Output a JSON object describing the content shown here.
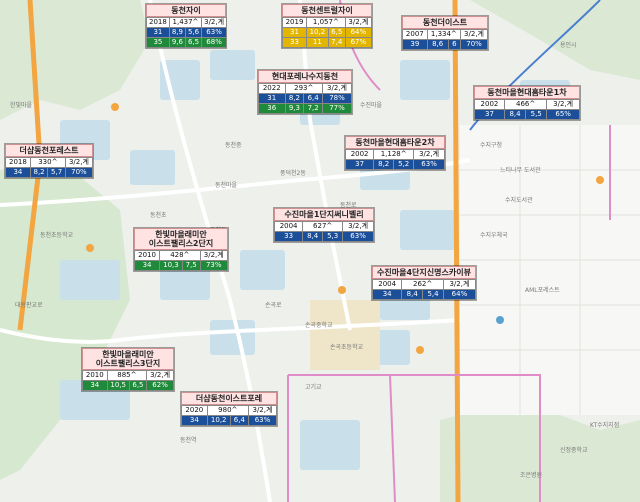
{
  "colors": {
    "title_bg": "#ffe3e3",
    "blue_row": "#1c4f9a",
    "green_row": "#1f8a3a",
    "yellow_row": "#e2b500",
    "road_pink": "#e08cc8",
    "road_orange": "#f2a540",
    "block_blue": "#c9e0ea"
  },
  "cards": [
    {
      "name": "동천자이",
      "title_lines": [
        "동천자이"
      ],
      "year": "2018",
      "units": "1,437^",
      "type": "3/2,계",
      "rows": [
        {
          "color": "blue",
          "cells": [
            "31",
            "8,9",
            "5,6",
            "63%"
          ]
        },
        {
          "color": "green",
          "cells": [
            "35",
            "9,6",
            "6,5",
            "68%"
          ]
        }
      ]
    },
    {
      "name": "동천센트럴자이",
      "title_lines": [
        "동천센트럴자이"
      ],
      "year": "2019",
      "units": "1,057^",
      "type": "3/2,계",
      "rows": [
        {
          "color": "yellow",
          "cells": [
            "31",
            "10,2",
            "6,5",
            "64%"
          ]
        },
        {
          "color": "yellow",
          "cells": [
            "33",
            "11",
            "7,4",
            "67%"
          ]
        }
      ]
    },
    {
      "name": "동천더이스트",
      "title_lines": [
        "동천더이스트"
      ],
      "year": "2007",
      "units": "1,334^",
      "type": "3/2,계",
      "rows": [
        {
          "color": "blue",
          "cells": [
            "39",
            "8,6",
            "6",
            "70%"
          ]
        }
      ]
    },
    {
      "name": "현대포레나수지동천",
      "title_lines": [
        "현대포레나수지동천"
      ],
      "year": "2022",
      "units": "293^",
      "type": "3/2,계",
      "rows": [
        {
          "color": "blue",
          "cells": [
            "31",
            "8,2",
            "6,4",
            "78%"
          ]
        },
        {
          "color": "green",
          "cells": [
            "36",
            "9,3",
            "7,2",
            "77%"
          ]
        }
      ]
    },
    {
      "name": "동천마을현대홈타운1차",
      "title_lines": [
        "동천마을현대홈타운1차"
      ],
      "year": "2002",
      "units": "466^",
      "type": "3/2,계",
      "rows": [
        {
          "color": "blue",
          "cells": [
            "37",
            "8,4",
            "5,5",
            "65%"
          ]
        }
      ]
    },
    {
      "name": "더샵동천포레스트",
      "title_lines": [
        "더샵동천포레스트"
      ],
      "year": "2018",
      "units": "330^",
      "type": "3/2,계",
      "rows": [
        {
          "color": "blue",
          "cells": [
            "34",
            "8,2",
            "5,7",
            "70%"
          ]
        }
      ]
    },
    {
      "name": "동천마을현대홈타운2차",
      "title_lines": [
        "동천마을현대홈타운2차"
      ],
      "year": "2002",
      "units": "1,128^",
      "type": "3/2,계",
      "rows": [
        {
          "color": "blue",
          "cells": [
            "37",
            "8,2",
            "5,2",
            "63%"
          ]
        }
      ]
    },
    {
      "name": "수진마을1단지써니벨리",
      "title_lines": [
        "수진마을1단지써니벨리"
      ],
      "year": "2004",
      "units": "627^",
      "type": "3/2,계",
      "rows": [
        {
          "color": "blue",
          "cells": [
            "33",
            "8,4",
            "5,3",
            "63%"
          ]
        }
      ]
    },
    {
      "name": "한빛마을래미안 이스트팰리스2단지",
      "title_lines": [
        "한빛마을래미안",
        "이스트팰리스2단지"
      ],
      "year": "2010",
      "units": "428^",
      "type": "3/2,계",
      "rows": [
        {
          "color": "green",
          "cells": [
            "34",
            "10,3",
            "7,5",
            "73%"
          ]
        }
      ]
    },
    {
      "name": "수진마을4단지신명스카이뷰",
      "title_lines": [
        "수진마을4단지신명스카이뷰"
      ],
      "year": "2004",
      "units": "262^",
      "type": "3/2,계",
      "rows": [
        {
          "color": "blue",
          "cells": [
            "34",
            "8,4",
            "5,4",
            "64%"
          ]
        }
      ]
    },
    {
      "name": "한빛마을래미안 이스트팰리스3단지",
      "title_lines": [
        "한빛마을래미안",
        "이스트팰리스3단지"
      ],
      "year": "2010",
      "units": "885^",
      "type": "3/2,계",
      "rows": [
        {
          "color": "green",
          "cells": [
            "34",
            "10,5",
            "6,5",
            "62%"
          ]
        }
      ]
    },
    {
      "name": "더샵동천이스트포레",
      "title_lines": [
        "더샵동천이스트포레"
      ],
      "year": "2020",
      "units": "980^",
      "type": "3/2,계",
      "rows": [
        {
          "color": "blue",
          "cells": [
            "34",
            "10,2",
            "6,4",
            "63%"
          ]
        }
      ]
    }
  ],
  "map_labels": {
    "a": "동천초",
    "b": "동천중",
    "c": "풍덕천2동",
    "d": "수지구청",
    "e": "손곡중학교",
    "f": "손곡초등학교",
    "g": "동천역",
    "h": "고기교",
    "i": "AML포레스트",
    "j": "수지우체국",
    "k": "동천초등학교",
    "l": "신정중학교",
    "m": "대왕판교로",
    "n": "손곡로",
    "o": "동천로",
    "p": "용인시",
    "q": "느티나무 도서관",
    "r": "수지도서관",
    "s": "한빛마을",
    "t": "수진마을",
    "u": "동천마을",
    "v": "KT수지지점",
    "w": "동천동",
    "x": "조은병원"
  }
}
